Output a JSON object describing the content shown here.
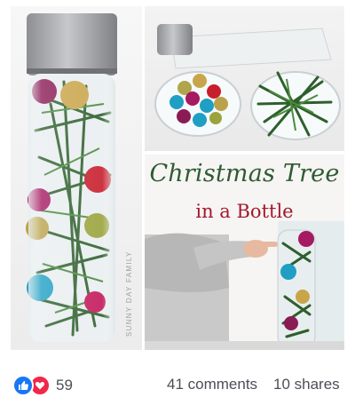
{
  "post": {
    "title_line1": "Christmas Tree",
    "title_line2": "in a Bottle",
    "watermark": "SUNNY DAY FAMILY"
  },
  "footer": {
    "reaction_count": "59",
    "comments": "41 comments",
    "shares": "10 shares",
    "like_icon": "thumbs-up-icon",
    "love_icon": "heart-icon"
  },
  "colors": {
    "like_blue": "#1877f2",
    "love_red": "#f02849",
    "title_green": "#2f5b33",
    "title_red": "#a3172d"
  }
}
